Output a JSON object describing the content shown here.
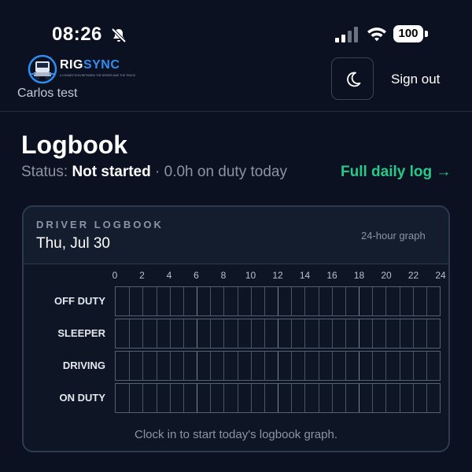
{
  "status_bar": {
    "time": "08:26",
    "battery": "100",
    "icons": [
      "bell-slash-icon",
      "signal-icon",
      "wifi-icon",
      "battery-icon"
    ]
  },
  "header": {
    "logo_rig": "RIG",
    "logo_sync": "SYNC",
    "logo_tagline": "A CONNECTION BETWEEN THE DRIVER AND THE TRUCK",
    "user_name": "Carlos test",
    "theme_toggle_icon": "moon-icon",
    "sign_out_label": "Sign out"
  },
  "page": {
    "title": "Logbook",
    "status_prefix": "Status:",
    "status_value": "Not started",
    "status_suffix": "· 0.0h on duty today",
    "full_log_link": "Full daily log →"
  },
  "logbook": {
    "section_label": "DRIVER LOGBOOK",
    "date": "Thu, Jul 30",
    "graph_note": "24-hour graph",
    "hour_ticks": [
      "0",
      "2",
      "4",
      "6",
      "8",
      "10",
      "12",
      "14",
      "16",
      "18",
      "20",
      "22",
      "24"
    ],
    "rows": [
      "OFF DUTY",
      "SLEEPER",
      "DRIVING",
      "ON DUTY"
    ],
    "empty_message": "Clock in to start today's logbook graph."
  },
  "colors": {
    "background": "#0b1120",
    "accent_green": "#27c98a",
    "logo_blue": "#2f8ef0"
  }
}
